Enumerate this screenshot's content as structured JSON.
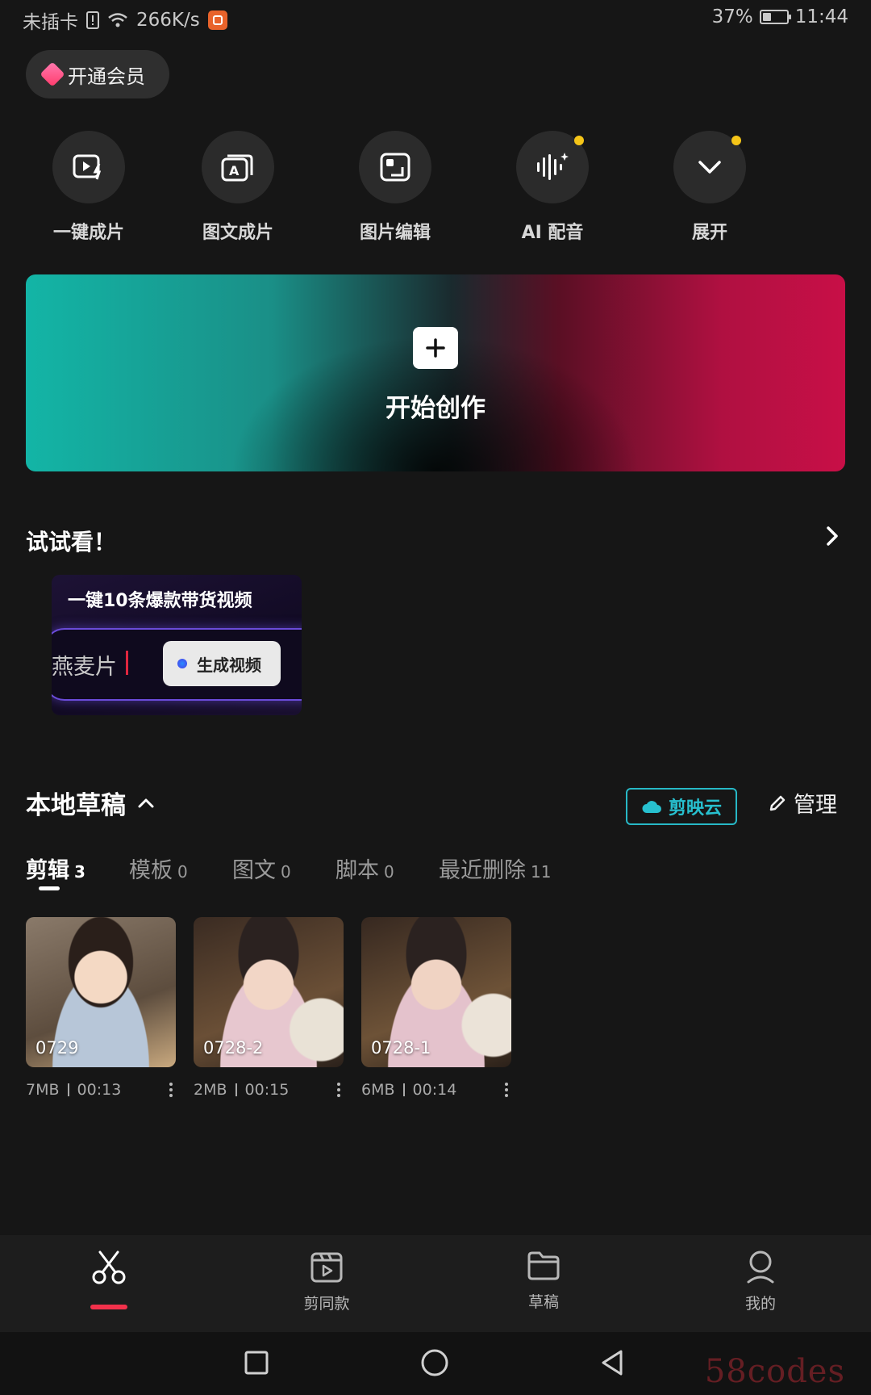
{
  "status_bar": {
    "carrier": "未插卡",
    "net_speed": "266K/s",
    "battery": "37%",
    "battery_level": 0.37,
    "time": "11:44"
  },
  "vip": {
    "label": "开通会员"
  },
  "tools": [
    {
      "label": "一键成片",
      "icon": "quick-video-icon"
    },
    {
      "label": "图文成片",
      "icon": "text-to-video-icon"
    },
    {
      "label": "图片编辑",
      "icon": "image-edit-icon"
    },
    {
      "label": "AI 配音",
      "icon": "ai-voice-icon",
      "badge": true
    },
    {
      "label": "展开",
      "icon": "chevron-down-icon",
      "badge": true
    }
  ],
  "hero": {
    "title": "开始创作",
    "icon": "plus-icon"
  },
  "try": {
    "title": "试试看！",
    "card": {
      "title": "一键10条爆款带货视频",
      "input_text": "燕麦片",
      "button": "生成视频"
    }
  },
  "drafts": {
    "title": "本地草稿",
    "cloud_label": "剪映云",
    "manage_label": "管理",
    "tabs": [
      {
        "label": "剪辑",
        "count": "3",
        "active": true
      },
      {
        "label": "模板",
        "count": "0"
      },
      {
        "label": "图文",
        "count": "0"
      },
      {
        "label": "脚本",
        "count": "0"
      },
      {
        "label": "最近删除",
        "count": "11"
      }
    ],
    "items": [
      {
        "name": "0729",
        "size": "7MB",
        "duration": "00:13"
      },
      {
        "name": "0728-2",
        "size": "2MB",
        "duration": "00:15"
      },
      {
        "name": "0728-1",
        "size": "6MB",
        "duration": "00:14"
      }
    ]
  },
  "bottom_nav": [
    {
      "label": "",
      "icon": "scissors-icon",
      "active": true
    },
    {
      "label": "剪同款",
      "icon": "template-video-icon"
    },
    {
      "label": "草稿",
      "icon": "folder-icon"
    },
    {
      "label": "我的",
      "icon": "user-icon"
    }
  ],
  "watermark": "58codes",
  "colors": {
    "accent": "#f2314b",
    "cloud": "#27b8c6",
    "badge": "#f5c518"
  }
}
